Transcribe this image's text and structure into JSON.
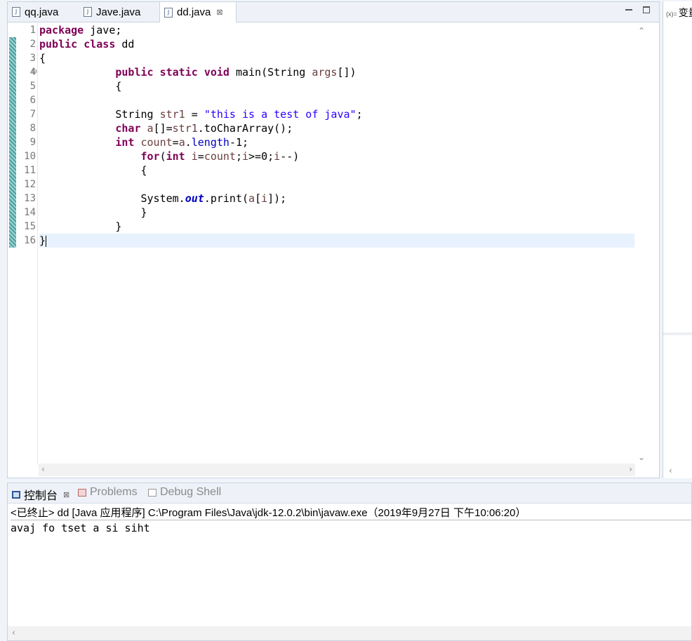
{
  "editor": {
    "tabs": [
      {
        "label": "qq.java",
        "active": false
      },
      {
        "label": "Jave.java",
        "active": false
      },
      {
        "label": "dd.java",
        "active": true
      }
    ],
    "close_glyph": "⊠",
    "line_numbers": [
      "1",
      "2",
      "3",
      "4",
      "5",
      "6",
      "7",
      "8",
      "9",
      "10",
      "11",
      "12",
      "13",
      "14",
      "15",
      "16"
    ],
    "fold_marker": "⊖",
    "current_line": 16,
    "code_lines": [
      [
        {
          "t": "package",
          "c": "kw"
        },
        {
          "t": " jave;"
        }
      ],
      [
        {
          "t": "public",
          "c": "kw"
        },
        {
          "t": " "
        },
        {
          "t": "class",
          "c": "kw"
        },
        {
          "t": " dd"
        }
      ],
      [
        {
          "t": "{"
        }
      ],
      [
        {
          "t": "            "
        },
        {
          "t": "public",
          "c": "kw"
        },
        {
          "t": " "
        },
        {
          "t": "static",
          "c": "kw"
        },
        {
          "t": " "
        },
        {
          "t": "void",
          "c": "kw"
        },
        {
          "t": " main(String "
        },
        {
          "t": "args",
          "c": "var"
        },
        {
          "t": "[])"
        }
      ],
      [
        {
          "t": "            {"
        }
      ],
      [
        {
          "t": ""
        }
      ],
      [
        {
          "t": "            String "
        },
        {
          "t": "str1",
          "c": "var"
        },
        {
          "t": " = "
        },
        {
          "t": "\"this is a test of java\"",
          "c": "str"
        },
        {
          "t": ";"
        }
      ],
      [
        {
          "t": "            "
        },
        {
          "t": "char",
          "c": "kw"
        },
        {
          "t": " "
        },
        {
          "t": "a",
          "c": "var"
        },
        {
          "t": "[]="
        },
        {
          "t": "str1",
          "c": "var"
        },
        {
          "t": ".toCharArray();"
        }
      ],
      [
        {
          "t": "            "
        },
        {
          "t": "int",
          "c": "kw"
        },
        {
          "t": " "
        },
        {
          "t": "count",
          "c": "var"
        },
        {
          "t": "="
        },
        {
          "t": "a",
          "c": "var"
        },
        {
          "t": "."
        },
        {
          "t": "length",
          "c": "fld"
        },
        {
          "t": "-1;"
        }
      ],
      [
        {
          "t": "                "
        },
        {
          "t": "for",
          "c": "kw"
        },
        {
          "t": "("
        },
        {
          "t": "int",
          "c": "kw"
        },
        {
          "t": " "
        },
        {
          "t": "i",
          "c": "var"
        },
        {
          "t": "="
        },
        {
          "t": "count",
          "c": "var"
        },
        {
          "t": ";"
        },
        {
          "t": "i",
          "c": "var"
        },
        {
          "t": ">=0;"
        },
        {
          "t": "i",
          "c": "var"
        },
        {
          "t": "--)"
        }
      ],
      [
        {
          "t": "                {"
        }
      ],
      [
        {
          "t": ""
        }
      ],
      [
        {
          "t": "                System."
        },
        {
          "t": "out",
          "c": "sfld"
        },
        {
          "t": ".print("
        },
        {
          "t": "a",
          "c": "var"
        },
        {
          "t": "["
        },
        {
          "t": "i",
          "c": "var"
        },
        {
          "t": "]);"
        }
      ],
      [
        {
          "t": "                }"
        }
      ],
      [
        {
          "t": "            }"
        }
      ],
      [
        {
          "t": "}"
        }
      ]
    ]
  },
  "variables_view": {
    "icon": "(x)=",
    "label": "变量"
  },
  "console": {
    "tabs": [
      {
        "label": "控制台",
        "active": true,
        "icon": "console-icon"
      },
      {
        "label": "Problems",
        "active": false,
        "icon": "problems-icon"
      },
      {
        "label": "Debug Shell",
        "active": false,
        "icon": "debug-shell-icon"
      }
    ],
    "close_glyph": "⊠",
    "status": "<已终止> dd [Java 应用程序] C:\\Program Files\\Java\\jdk-12.0.2\\bin\\javaw.exe（2019年9月27日 下午10:06:20）",
    "output": "avaj fo tset a si siht"
  },
  "colors": {
    "keyword": "#7f0055",
    "string": "#2a00ff",
    "variable": "#6a3e3e",
    "field": "#0000c0",
    "current_line": "#e8f2fe"
  }
}
